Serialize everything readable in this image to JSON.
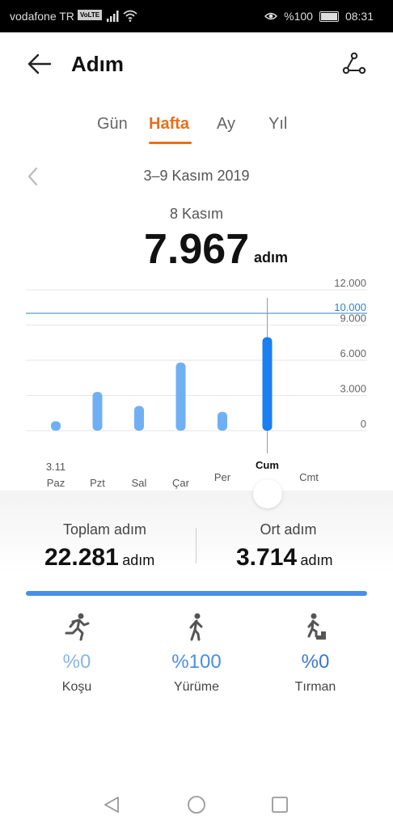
{
  "status_bar": {
    "carrier": "vodafone TR",
    "volte": "VoLTE",
    "battery_text": "%100",
    "time": "08:31"
  },
  "header": {
    "title": "Adım",
    "back_icon": "arrow-left-icon",
    "share_icon": "share-icon"
  },
  "tabs": [
    "Gün",
    "Hafta",
    "Ay",
    "Yıl"
  ],
  "active_tab": "Hafta",
  "date_range": "3–9 Kasım 2019",
  "selected": {
    "day": "8 Kasım",
    "value": "7.967",
    "unit": "adım"
  },
  "chart_data": {
    "type": "bar",
    "categories": [
      "Paz",
      "Pzt",
      "Sal",
      "Çar",
      "Per",
      "Cum",
      "Cmt"
    ],
    "first_date_label": "3.11",
    "values": [
      800,
      3300,
      2100,
      5800,
      1600,
      7967,
      0
    ],
    "selected_index": 5,
    "goal": 10000,
    "goal_label": "10.000",
    "y_ticks": [
      "12.000",
      "9.000",
      "6.000",
      "3.000",
      "0"
    ],
    "ylim": [
      0,
      12000
    ],
    "bar_color": "#6fb0f5",
    "selected_bar_color": "#1a7ff0",
    "goal_color": "#2b86c5"
  },
  "summary": {
    "total_label": "Toplam adım",
    "total_value": "22.281",
    "avg_label": "Ort adım",
    "avg_value": "3.714",
    "unit": "adım"
  },
  "activities": [
    {
      "icon": "running-icon",
      "percent": "%0",
      "label": "Koşu",
      "color": "#86b6ea"
    },
    {
      "icon": "walking-icon",
      "percent": "%100",
      "label": "Yürüme",
      "color": "#4a8fe7"
    },
    {
      "icon": "climbing-icon",
      "percent": "%0",
      "label": "Tırman",
      "color": "#3a78d0"
    }
  ],
  "nav": {
    "back_icon": "nav-back-icon",
    "home_icon": "nav-home-icon",
    "recents_icon": "nav-recents-icon"
  }
}
